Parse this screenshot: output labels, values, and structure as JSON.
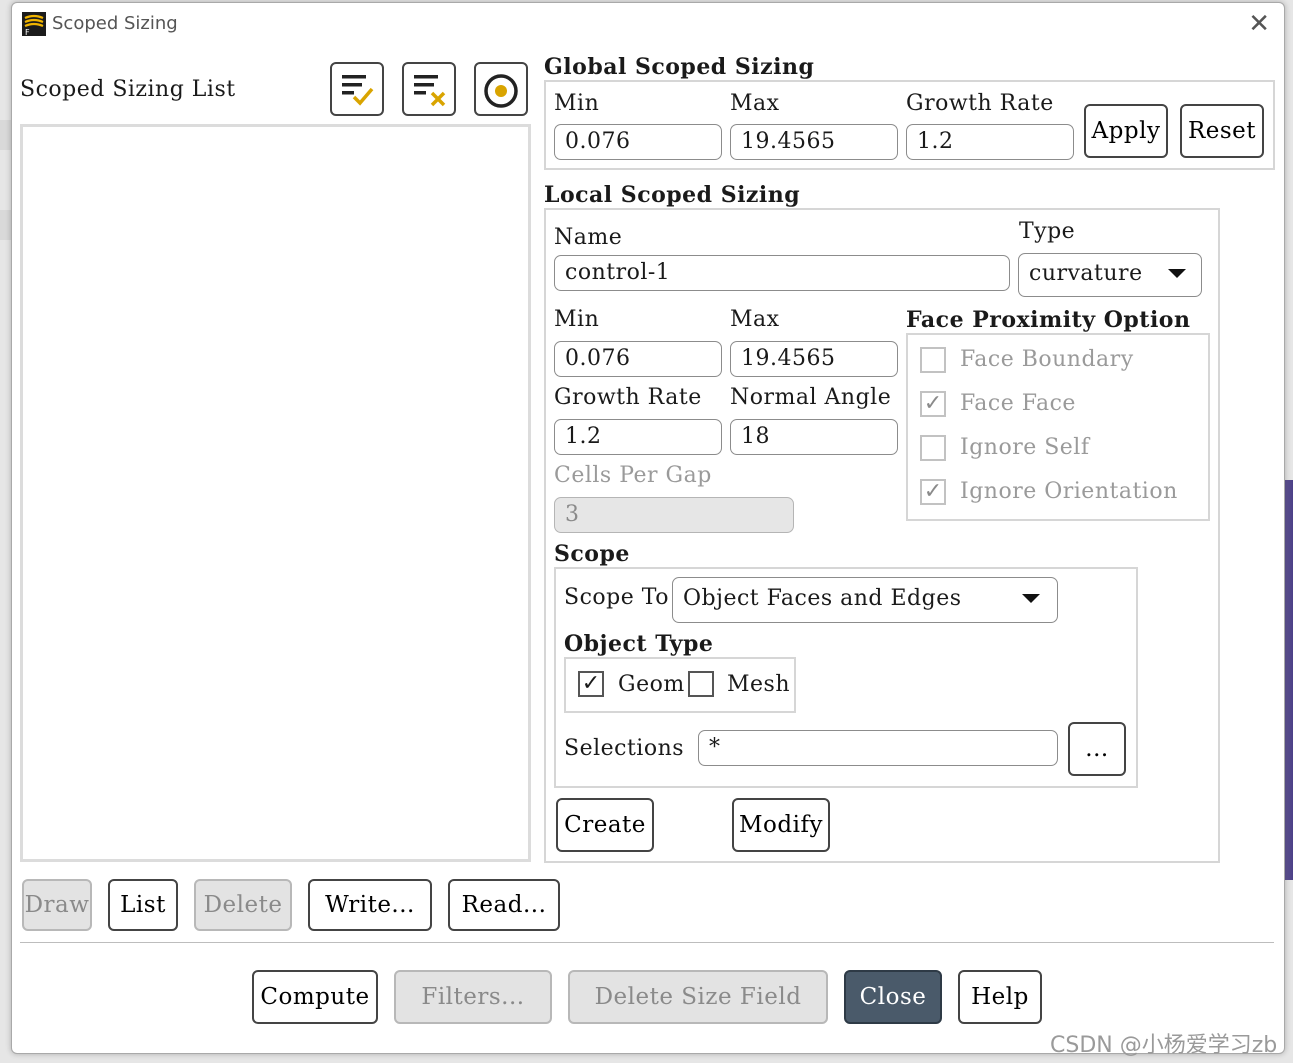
{
  "window": {
    "title": "Scoped Sizing",
    "close_glyph": "✕"
  },
  "list_panel": {
    "title": "Scoped Sizing List",
    "icons": [
      "select-all-icon",
      "deselect-all-icon",
      "target-icon"
    ],
    "buttons": {
      "draw": "Draw",
      "list": "List",
      "delete": "Delete",
      "write": "Write...",
      "read": "Read..."
    }
  },
  "global": {
    "title": "Global Scoped Sizing",
    "min_label": "Min",
    "min_value": "0.076",
    "max_label": "Max",
    "max_value": "19.4565",
    "growth_label": "Growth Rate",
    "growth_value": "1.2",
    "apply": "Apply",
    "reset": "Reset"
  },
  "local": {
    "title": "Local Scoped Sizing",
    "name_label": "Name",
    "name_value": "control-1",
    "type_label": "Type",
    "type_value": "curvature",
    "min_label": "Min",
    "min_value": "0.076",
    "max_label": "Max",
    "max_value": "19.4565",
    "growth_label": "Growth Rate",
    "growth_value": "1.2",
    "normal_angle_label": "Normal Angle",
    "normal_angle_value": "18",
    "cells_per_gap_label": "Cells Per Gap",
    "cells_per_gap_value": "3",
    "face_proximity": {
      "title": "Face Proximity Option",
      "options": [
        {
          "label": "Face Boundary",
          "checked": false
        },
        {
          "label": "Face Face",
          "checked": true
        },
        {
          "label": "Ignore Self",
          "checked": false
        },
        {
          "label": "Ignore Orientation",
          "checked": true
        }
      ]
    },
    "scope": {
      "title": "Scope",
      "scope_to_label": "Scope To",
      "scope_to_value": "Object Faces and Edges",
      "object_type_label": "Object Type",
      "geom_label": "Geom",
      "geom_checked": true,
      "mesh_label": "Mesh",
      "mesh_checked": false,
      "selections_label": "Selections",
      "selections_value": "*",
      "browse": "..."
    },
    "create": "Create",
    "modify": "Modify"
  },
  "footer": {
    "compute": "Compute",
    "filters": "Filters...",
    "delete_size_field": "Delete Size Field",
    "close": "Close",
    "help": "Help"
  },
  "check_glyph": "✓",
  "watermark": "CSDN @小杨爱学习zb"
}
